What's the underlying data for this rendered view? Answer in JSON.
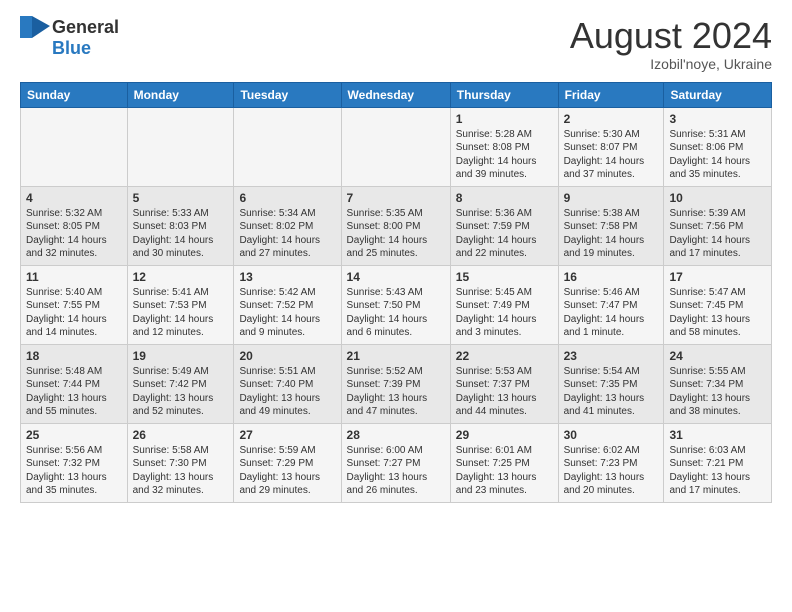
{
  "logo": {
    "text_general": "General",
    "text_blue": "Blue"
  },
  "title": {
    "month_year": "August 2024",
    "location": "Izobil'noye, Ukraine"
  },
  "headers": [
    "Sunday",
    "Monday",
    "Tuesday",
    "Wednesday",
    "Thursday",
    "Friday",
    "Saturday"
  ],
  "weeks": [
    [
      {
        "day": "",
        "info": ""
      },
      {
        "day": "",
        "info": ""
      },
      {
        "day": "",
        "info": ""
      },
      {
        "day": "",
        "info": ""
      },
      {
        "day": "1",
        "info": "Sunrise: 5:28 AM\nSunset: 8:08 PM\nDaylight: 14 hours\nand 39 minutes."
      },
      {
        "day": "2",
        "info": "Sunrise: 5:30 AM\nSunset: 8:07 PM\nDaylight: 14 hours\nand 37 minutes."
      },
      {
        "day": "3",
        "info": "Sunrise: 5:31 AM\nSunset: 8:06 PM\nDaylight: 14 hours\nand 35 minutes."
      }
    ],
    [
      {
        "day": "4",
        "info": "Sunrise: 5:32 AM\nSunset: 8:05 PM\nDaylight: 14 hours\nand 32 minutes."
      },
      {
        "day": "5",
        "info": "Sunrise: 5:33 AM\nSunset: 8:03 PM\nDaylight: 14 hours\nand 30 minutes."
      },
      {
        "day": "6",
        "info": "Sunrise: 5:34 AM\nSunset: 8:02 PM\nDaylight: 14 hours\nand 27 minutes."
      },
      {
        "day": "7",
        "info": "Sunrise: 5:35 AM\nSunset: 8:00 PM\nDaylight: 14 hours\nand 25 minutes."
      },
      {
        "day": "8",
        "info": "Sunrise: 5:36 AM\nSunset: 7:59 PM\nDaylight: 14 hours\nand 22 minutes."
      },
      {
        "day": "9",
        "info": "Sunrise: 5:38 AM\nSunset: 7:58 PM\nDaylight: 14 hours\nand 19 minutes."
      },
      {
        "day": "10",
        "info": "Sunrise: 5:39 AM\nSunset: 7:56 PM\nDaylight: 14 hours\nand 17 minutes."
      }
    ],
    [
      {
        "day": "11",
        "info": "Sunrise: 5:40 AM\nSunset: 7:55 PM\nDaylight: 14 hours\nand 14 minutes."
      },
      {
        "day": "12",
        "info": "Sunrise: 5:41 AM\nSunset: 7:53 PM\nDaylight: 14 hours\nand 12 minutes."
      },
      {
        "day": "13",
        "info": "Sunrise: 5:42 AM\nSunset: 7:52 PM\nDaylight: 14 hours\nand 9 minutes."
      },
      {
        "day": "14",
        "info": "Sunrise: 5:43 AM\nSunset: 7:50 PM\nDaylight: 14 hours\nand 6 minutes."
      },
      {
        "day": "15",
        "info": "Sunrise: 5:45 AM\nSunset: 7:49 PM\nDaylight: 14 hours\nand 3 minutes."
      },
      {
        "day": "16",
        "info": "Sunrise: 5:46 AM\nSunset: 7:47 PM\nDaylight: 14 hours\nand 1 minute."
      },
      {
        "day": "17",
        "info": "Sunrise: 5:47 AM\nSunset: 7:45 PM\nDaylight: 13 hours\nand 58 minutes."
      }
    ],
    [
      {
        "day": "18",
        "info": "Sunrise: 5:48 AM\nSunset: 7:44 PM\nDaylight: 13 hours\nand 55 minutes."
      },
      {
        "day": "19",
        "info": "Sunrise: 5:49 AM\nSunset: 7:42 PM\nDaylight: 13 hours\nand 52 minutes."
      },
      {
        "day": "20",
        "info": "Sunrise: 5:51 AM\nSunset: 7:40 PM\nDaylight: 13 hours\nand 49 minutes."
      },
      {
        "day": "21",
        "info": "Sunrise: 5:52 AM\nSunset: 7:39 PM\nDaylight: 13 hours\nand 47 minutes."
      },
      {
        "day": "22",
        "info": "Sunrise: 5:53 AM\nSunset: 7:37 PM\nDaylight: 13 hours\nand 44 minutes."
      },
      {
        "day": "23",
        "info": "Sunrise: 5:54 AM\nSunset: 7:35 PM\nDaylight: 13 hours\nand 41 minutes."
      },
      {
        "day": "24",
        "info": "Sunrise: 5:55 AM\nSunset: 7:34 PM\nDaylight: 13 hours\nand 38 minutes."
      }
    ],
    [
      {
        "day": "25",
        "info": "Sunrise: 5:56 AM\nSunset: 7:32 PM\nDaylight: 13 hours\nand 35 minutes."
      },
      {
        "day": "26",
        "info": "Sunrise: 5:58 AM\nSunset: 7:30 PM\nDaylight: 13 hours\nand 32 minutes."
      },
      {
        "day": "27",
        "info": "Sunrise: 5:59 AM\nSunset: 7:29 PM\nDaylight: 13 hours\nand 29 minutes."
      },
      {
        "day": "28",
        "info": "Sunrise: 6:00 AM\nSunset: 7:27 PM\nDaylight: 13 hours\nand 26 minutes."
      },
      {
        "day": "29",
        "info": "Sunrise: 6:01 AM\nSunset: 7:25 PM\nDaylight: 13 hours\nand 23 minutes."
      },
      {
        "day": "30",
        "info": "Sunrise: 6:02 AM\nSunset: 7:23 PM\nDaylight: 13 hours\nand 20 minutes."
      },
      {
        "day": "31",
        "info": "Sunrise: 6:03 AM\nSunset: 7:21 PM\nDaylight: 13 hours\nand 17 minutes."
      }
    ]
  ]
}
